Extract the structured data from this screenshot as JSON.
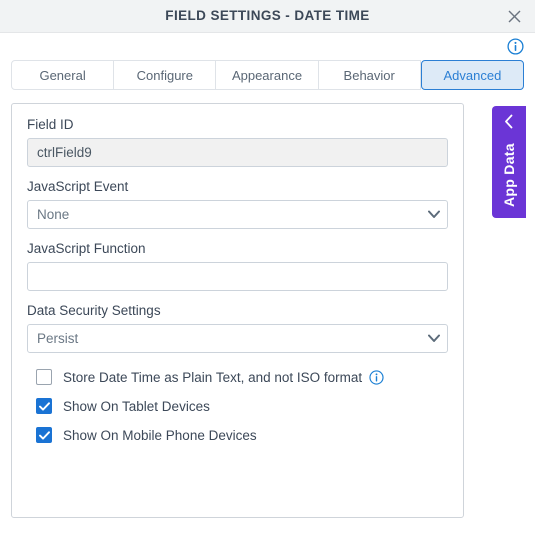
{
  "dialog": {
    "title": "FIELD SETTINGS - DATE TIME",
    "close_icon": "close-icon",
    "info_icon": "info-circle-icon"
  },
  "tabs": [
    {
      "label": "General",
      "active": false
    },
    {
      "label": "Configure",
      "active": false
    },
    {
      "label": "Appearance",
      "active": false
    },
    {
      "label": "Behavior",
      "active": false
    },
    {
      "label": "Advanced",
      "active": true
    }
  ],
  "form": {
    "field_id": {
      "label": "Field ID",
      "value": "ctrlField9",
      "placeholder": ""
    },
    "javascript_event": {
      "label": "JavaScript Event",
      "value": "None",
      "options": [
        "None"
      ]
    },
    "javascript_function": {
      "label": "JavaScript Function",
      "value": "",
      "placeholder": ""
    },
    "data_security_settings": {
      "label": "Data Security Settings",
      "value": "Persist",
      "options": [
        "Persist"
      ]
    },
    "checkboxes": [
      {
        "label": "Store Date Time as Plain Text, and not ISO format",
        "checked": false,
        "has_info_icon": true
      },
      {
        "label": "Show On Tablet Devices",
        "checked": true,
        "has_info_icon": false
      },
      {
        "label": "Show On Mobile Phone Devices",
        "checked": true,
        "has_info_icon": false
      }
    ]
  },
  "app_data_tab": {
    "label": "App Data",
    "chevron_icon": "chevron-left-icon",
    "color": "#6b35d6"
  },
  "colors": {
    "accent_blue": "#2b7fd4",
    "checkbox_blue": "#1a73d4",
    "purple": "#6b35d6",
    "titlebar_bg": "#f1f3f4",
    "label_text": "#3c4858"
  }
}
